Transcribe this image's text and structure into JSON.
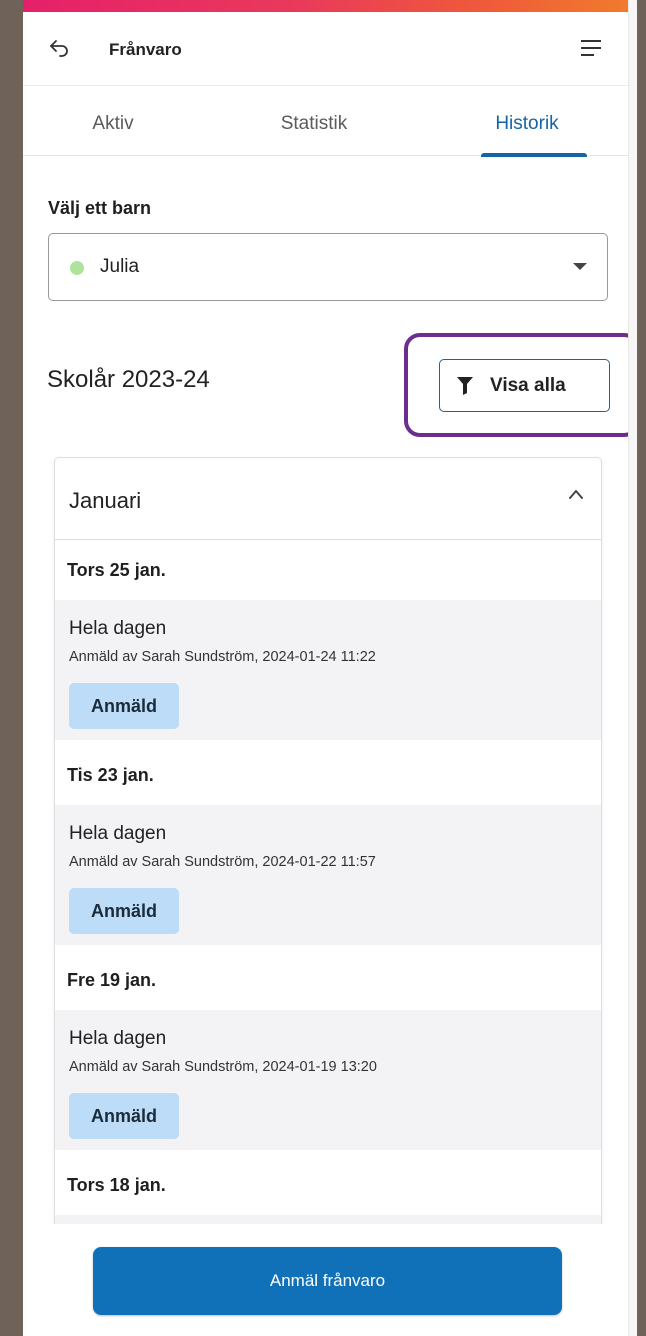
{
  "header": {
    "title": "Frånvaro",
    "back_icon": "back-arrow-icon",
    "menu_icon": "hamburger-menu-icon"
  },
  "tabs": [
    {
      "label": "Aktiv",
      "active": false
    },
    {
      "label": "Statistik",
      "active": false
    },
    {
      "label": "Historik",
      "active": true
    }
  ],
  "child_select": {
    "label": "Välj ett barn",
    "value": "Julia",
    "dot_color": "#aee39b"
  },
  "school_year": {
    "title": "Skolår 2023-24"
  },
  "filter": {
    "label": "Visa alla",
    "icon": "filter-icon"
  },
  "month": {
    "title": "Januari",
    "expanded": true,
    "days": [
      {
        "date": "Tors 25 jan.",
        "entry": {
          "title": "Hela dagen",
          "meta": "Anmäld av Sarah Sundström, 2024-01-24 11:22",
          "status": "Anmäld"
        }
      },
      {
        "date": "Tis 23 jan.",
        "entry": {
          "title": "Hela dagen",
          "meta": "Anmäld av Sarah Sundström, 2024-01-22 11:57",
          "status": "Anmäld"
        }
      },
      {
        "date": "Fre 19 jan.",
        "entry": {
          "title": "Hela dagen",
          "meta": "Anmäld av Sarah Sundström, 2024-01-19 13:20",
          "status": "Anmäld"
        }
      },
      {
        "date": "Tors 18 jan."
      }
    ]
  },
  "footer": {
    "button_label": "Anmäl frånvaro"
  },
  "colors": {
    "accent": "#1565a6",
    "primary_button": "#1171b8",
    "badge_bg": "#bcdcf7",
    "highlight": "#6b2e8e"
  }
}
